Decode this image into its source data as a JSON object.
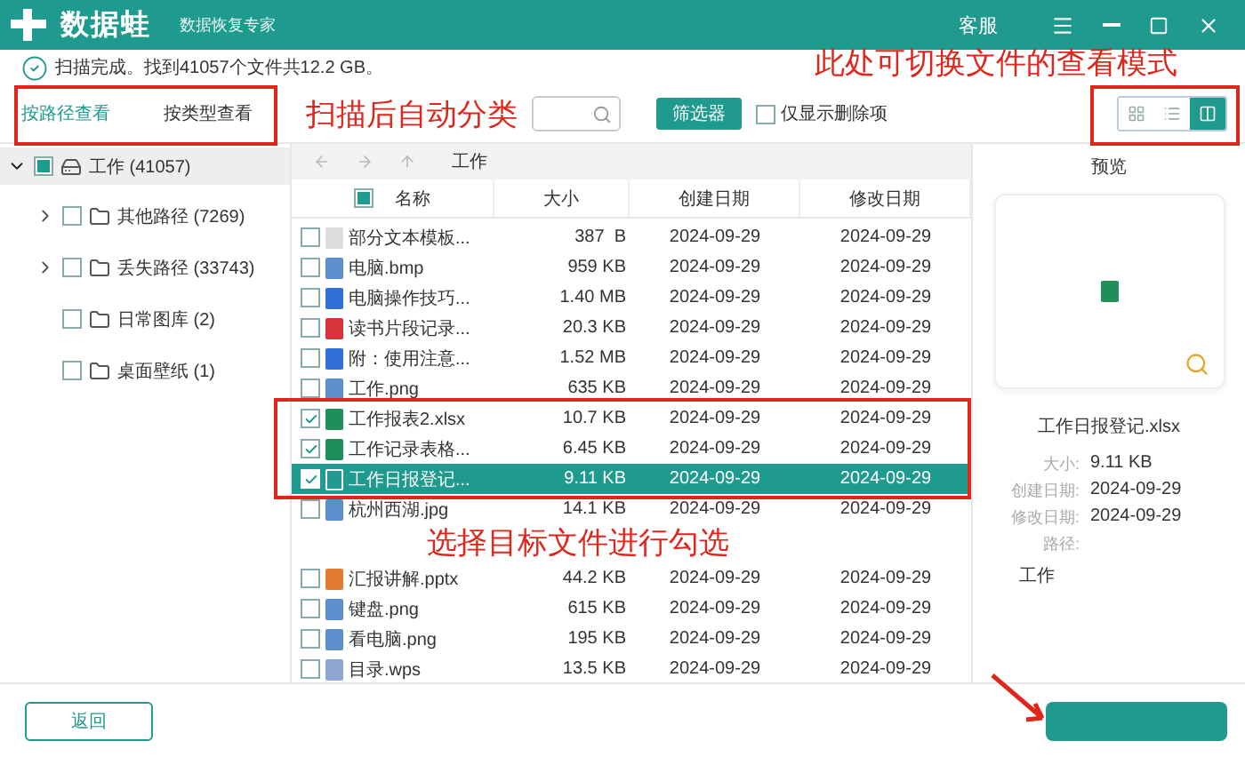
{
  "app": {
    "name": "数据蛙",
    "subtitle": "数据恢复专家",
    "service": "客服"
  },
  "status": "扫描完成。找到41057个文件共12.2 GB。",
  "view_tabs": [
    {
      "label": "按路径查看",
      "selected": true
    },
    {
      "label": "按类型查看",
      "selected": false
    }
  ],
  "filter_button": "筛选器",
  "deleted_only": {
    "label": "仅显示删除项",
    "checked": false
  },
  "view_modes": [
    {
      "kind": "grid",
      "selected": false
    },
    {
      "kind": "list",
      "selected": false
    },
    {
      "kind": "preview",
      "selected": true
    }
  ],
  "tree": [
    {
      "label": "工作 (41057)",
      "kind": "drive",
      "checked": false,
      "indeterminate": true,
      "expandable": true,
      "expanded": true,
      "children": [
        {
          "label": "其他路径 (7269)",
          "kind": "folder",
          "checked": false,
          "indeterminate": false,
          "expandable": true,
          "expanded": false
        },
        {
          "label": "丢失路径 (33743)",
          "kind": "folder",
          "checked": false,
          "indeterminate": false,
          "expandable": true,
          "expanded": false
        },
        {
          "label": "日常图库 (2)",
          "kind": "folder",
          "checked": false,
          "indeterminate": false,
          "expandable": false
        },
        {
          "label": "桌面壁纸 (1)",
          "kind": "folder",
          "checked": false,
          "indeterminate": false,
          "expandable": false
        }
      ]
    }
  ],
  "path": "工作",
  "select_all": {
    "checked": false,
    "indeterminate": true
  },
  "columns": [
    "名称",
    "大小",
    "创建日期",
    "修改日期"
  ],
  "rows": [
    {
      "kind": "blank",
      "name": "部分文本模板...",
      "size": "387  B",
      "created": "2024-09-29",
      "modified": "2024-09-29",
      "checked": false,
      "selected": false
    },
    {
      "kind": "image",
      "name": "电脑.bmp",
      "size": "959 KB",
      "created": "2024-09-29",
      "modified": "2024-09-29",
      "checked": false,
      "selected": false
    },
    {
      "kind": "doc",
      "name": "电脑操作技巧...",
      "size": "1.40 MB",
      "created": "2024-09-29",
      "modified": "2024-09-29",
      "checked": false,
      "selected": false
    },
    {
      "kind": "pdf",
      "name": "读书片段记录...",
      "size": "20.3 KB",
      "created": "2024-09-29",
      "modified": "2024-09-29",
      "checked": false,
      "selected": false
    },
    {
      "kind": "doc",
      "name": "附：使用注意...",
      "size": "1.52 MB",
      "created": "2024-09-29",
      "modified": "2024-09-29",
      "checked": false,
      "selected": false
    },
    {
      "kind": "image",
      "name": "工作.png",
      "size": "635 KB",
      "created": "2024-09-29",
      "modified": "2024-09-29",
      "checked": false,
      "selected": false
    },
    {
      "kind": "xlsx",
      "name": "工作报表2.xlsx",
      "size": "10.7 KB",
      "created": "2024-09-29",
      "modified": "2024-09-29",
      "checked": true,
      "selected": false
    },
    {
      "kind": "xlsx",
      "name": "工作记录表格...",
      "size": "6.45 KB",
      "created": "2024-09-29",
      "modified": "2024-09-29",
      "checked": true,
      "selected": false
    },
    {
      "kind": "text",
      "name": "工作日报登记...",
      "size": "9.11 KB",
      "created": "2024-09-29",
      "modified": "2024-09-29",
      "checked": true,
      "selected": true
    },
    {
      "kind": "image",
      "name": "杭州西湖.jpg",
      "size": "14.1 KB",
      "created": "2024-09-29",
      "modified": "2024-09-29",
      "checked": false,
      "selected": false
    },
    {
      "kind": "pptx",
      "name": "汇报讲解.pptx",
      "size": "44.2 KB",
      "created": "2024-09-29",
      "modified": "2024-09-29",
      "checked": false,
      "selected": false
    },
    {
      "kind": "image",
      "name": "键盘.png",
      "size": "615 KB",
      "created": "2024-09-29",
      "modified": "2024-09-29",
      "checked": false,
      "selected": false
    },
    {
      "kind": "image",
      "name": "看电脑.png",
      "size": "195 KB",
      "created": "2024-09-29",
      "modified": "2024-09-29",
      "checked": false,
      "selected": false
    },
    {
      "kind": "wps",
      "name": "目录.wps",
      "size": "13.5 KB",
      "created": "2024-09-29",
      "modified": "2024-09-29",
      "checked": false,
      "selected": false
    }
  ],
  "preview": {
    "title": "预览",
    "file_name": "工作日报登记.xlsx",
    "details": [
      {
        "label": "大小:",
        "value": "9.11 KB"
      },
      {
        "label": "创建日期:",
        "value": "2024-09-29"
      },
      {
        "label": "修改日期:",
        "value": "2024-09-29"
      },
      {
        "label": "路径:"
      }
    ],
    "path": "工作"
  },
  "back_button": "返回",
  "annotations": [
    "此处可切换文件的查看模式",
    "扫描后自动分类",
    "选择目标文件进行勾选"
  ]
}
